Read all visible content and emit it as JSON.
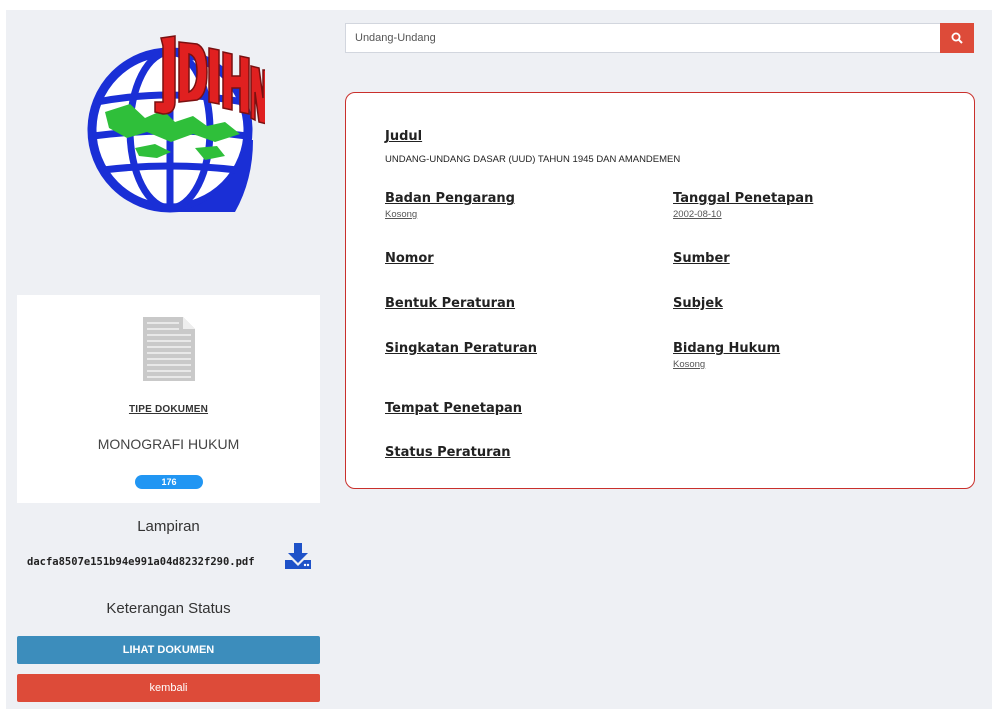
{
  "logo": {
    "text": "JDIHN",
    "colors": {
      "globe": "#1a2fd6",
      "land": "#2fbf3a",
      "text": "#e02020"
    }
  },
  "doc_card": {
    "icon": "document-icon",
    "tipe_label": "TIPE DOKUMEN",
    "tipe_value": "MONOGRAFI HUKUM",
    "count": "176"
  },
  "lampiran": {
    "title": "Lampiran",
    "file_name": "dacfa8507e151b94e991a04d8232f290.pdf",
    "download_icon": "download-icon"
  },
  "keterangan_status": {
    "title": "Keterangan Status"
  },
  "buttons": {
    "lihat": "LIHAT DOKUMEN",
    "kembali": "kembali"
  },
  "search": {
    "placeholder": "Undang-Undang",
    "icon": "search-icon"
  },
  "detail": {
    "judul": {
      "label": "Judul",
      "value": "UNDANG-UNDANG DASAR (UUD) TAHUN 1945 DAN AMANDEMEN"
    },
    "badan_pengarang": {
      "label": "Badan Pengarang",
      "value": "Kosong"
    },
    "tanggal_penetapan": {
      "label": "Tanggal Penetapan",
      "value": "2002-08-10"
    },
    "nomor": {
      "label": "Nomor"
    },
    "sumber": {
      "label": "Sumber"
    },
    "bentuk_peraturan": {
      "label": "Bentuk Peraturan"
    },
    "subjek": {
      "label": "Subjek"
    },
    "singkatan_peraturan": {
      "label": "Singkatan Peraturan"
    },
    "bidang_hukum": {
      "label": "Bidang Hukum",
      "value": "Kosong"
    },
    "tempat_penetapan": {
      "label": "Tempat Penetapan"
    },
    "status_peraturan": {
      "label": "Status Peraturan"
    }
  },
  "colors": {
    "primary": "#3c8dbc",
    "danger": "#dd4b39",
    "badge": "#2196f3",
    "background": "#eef0f4"
  }
}
